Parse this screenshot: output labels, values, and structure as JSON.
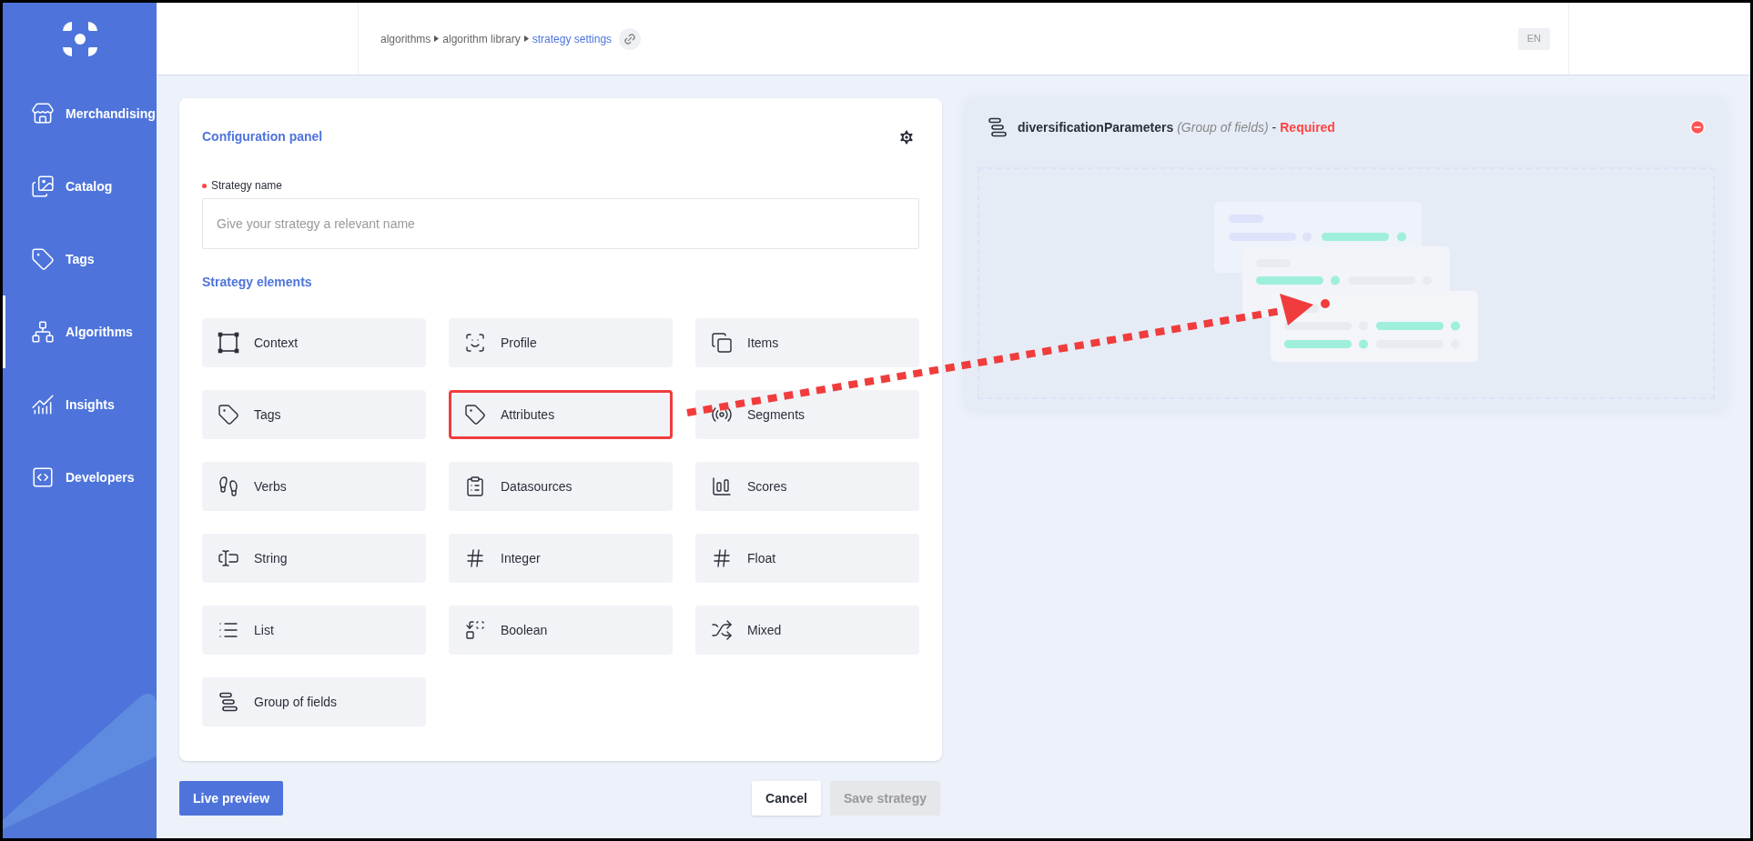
{
  "sidebar": {
    "items": [
      {
        "label": "Merchandising",
        "selected": false
      },
      {
        "label": "Catalog",
        "selected": false
      },
      {
        "label": "Tags",
        "selected": false
      },
      {
        "label": "Algorithms",
        "selected": true
      },
      {
        "label": "Insights",
        "selected": false
      },
      {
        "label": "Developers",
        "selected": false
      }
    ]
  },
  "breadcrumb": [
    {
      "label": "algorithms",
      "current": false
    },
    {
      "label": "algorithm library",
      "current": false
    },
    {
      "label": "strategy settings",
      "current": true
    }
  ],
  "language": "EN",
  "config_panel": {
    "title": "Configuration panel",
    "name_field": {
      "label": "Strategy name",
      "required": true,
      "placeholder": "Give your strategy a relevant name"
    },
    "elements_title": "Strategy elements",
    "elements": [
      {
        "label": "Context",
        "highlighted": false
      },
      {
        "label": "Profile",
        "highlighted": false
      },
      {
        "label": "Items",
        "highlighted": false
      },
      {
        "label": "Tags",
        "highlighted": false
      },
      {
        "label": "Attributes",
        "highlighted": true
      },
      {
        "label": "Segments",
        "highlighted": false
      },
      {
        "label": "Verbs",
        "highlighted": false
      },
      {
        "label": "Datasources",
        "highlighted": false
      },
      {
        "label": "Scores",
        "highlighted": false
      },
      {
        "label": "String",
        "highlighted": false
      },
      {
        "label": "Integer",
        "highlighted": false
      },
      {
        "label": "Float",
        "highlighted": false
      },
      {
        "label": "List",
        "highlighted": false
      },
      {
        "label": "Boolean",
        "highlighted": false
      },
      {
        "label": "Mixed",
        "highlighted": false
      },
      {
        "label": "Group of fields",
        "highlighted": false
      }
    ]
  },
  "field_panel": {
    "name": "diversificationParameters",
    "type": "(Group of fields)",
    "separator": "-",
    "required_label": "Required"
  },
  "buttons": [
    {
      "label": "Live preview",
      "disabled": false
    },
    {
      "label": "Cancel",
      "disabled": false
    },
    {
      "label": "Save strategy",
      "disabled": true
    }
  ]
}
